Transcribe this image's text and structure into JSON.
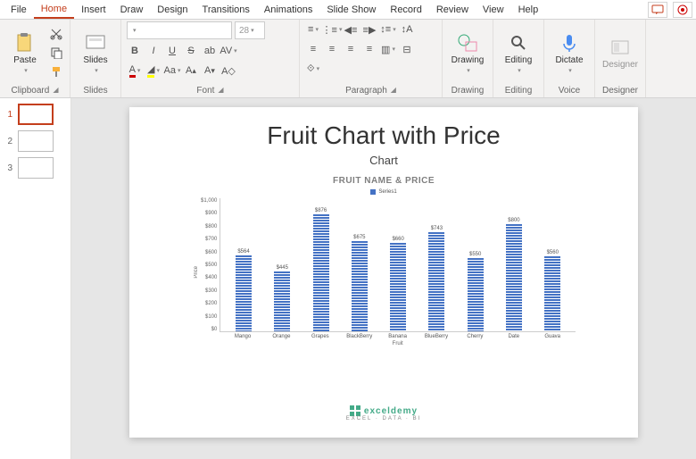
{
  "menubar": {
    "tabs": [
      "File",
      "Home",
      "Insert",
      "Draw",
      "Design",
      "Transitions",
      "Animations",
      "Slide Show",
      "Record",
      "Review",
      "View",
      "Help"
    ],
    "active": 1
  },
  "ribbon": {
    "clipboard": {
      "paste": "Paste",
      "label": "Clipboard"
    },
    "slides": {
      "slides": "Slides",
      "label": "Slides"
    },
    "font": {
      "size": "28",
      "label": "Font"
    },
    "paragraph": {
      "label": "Paragraph"
    },
    "drawing": {
      "btn": "Drawing",
      "label": "Drawing"
    },
    "editing": {
      "btn": "Editing",
      "label": "Editing"
    },
    "voice": {
      "btn": "Dictate",
      "label": "Voice"
    },
    "designer": {
      "btn": "Designer",
      "label": "Designer"
    }
  },
  "thumbs": {
    "items": [
      {
        "n": "1"
      },
      {
        "n": "2"
      },
      {
        "n": "3"
      }
    ],
    "active": 0
  },
  "slide": {
    "title": "Fruit Chart with Price",
    "subtitle": "Chart",
    "chart_title": "FRUIT NAME & PRICE",
    "legend": "Series1",
    "xlabel": "Fruit",
    "ylabel": "Price",
    "brand": "exceldemy",
    "brand_sub": "EXCEL · DATA · BI"
  },
  "chart_data": {
    "type": "bar",
    "title": "FRUIT NAME & PRICE",
    "xlabel": "Fruit",
    "ylabel": "Price",
    "ylim": [
      0,
      1000
    ],
    "yticks": [
      "$1,000",
      "$900",
      "$800",
      "$700",
      "$600",
      "$500",
      "$400",
      "$300",
      "$200",
      "$100",
      "$0"
    ],
    "categories": [
      "Mango",
      "Orange",
      "Grapes",
      "BlackBerry",
      "Banana",
      "BlueBerry",
      "Cherry",
      "Date",
      "Guava"
    ],
    "values": [
      564,
      445,
      876,
      675,
      660,
      743,
      550,
      800,
      560
    ],
    "data_labels": [
      "$564",
      "$445",
      "$876",
      "$675",
      "$660",
      "$743",
      "$550",
      "$800",
      "$560"
    ],
    "series": [
      {
        "name": "Series1",
        "values": [
          564,
          445,
          876,
          675,
          660,
          743,
          550,
          800,
          560
        ]
      }
    ]
  }
}
